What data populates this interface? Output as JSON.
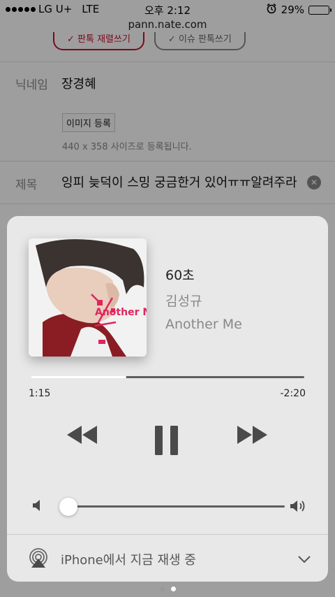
{
  "status_bar": {
    "carrier": "LG U+",
    "network": "LTE",
    "time": "오후 2:12",
    "battery_percent": "29%",
    "battery_level": 0.29
  },
  "webpage": {
    "url": "pann.nate.com",
    "tab_left": "✓ 판톡 재렬쓰기",
    "tab_right": "✓ 이슈 판톡쓰기",
    "nickname_label": "닉네임",
    "nickname_value": "장경혜",
    "image_button": "이미지 등록",
    "image_hint": "440 x 358 사이즈로 등록됩니다.",
    "title_label": "제목",
    "title_value": "잉피 늦덕이 스밍 궁금한거 있어ㅠㅠ알려주라"
  },
  "now_playing": {
    "song": "60초",
    "artist": "김성규",
    "album": "Another Me",
    "elapsed": "1:15",
    "remaining": "-2:20",
    "progress": 0.35,
    "volume": 0.03,
    "album_art_text": "Another Me"
  },
  "airplay": {
    "label": "iPhone에서 지금 재생 중"
  },
  "page_indicator": {
    "count": 2,
    "active_index": 1
  }
}
